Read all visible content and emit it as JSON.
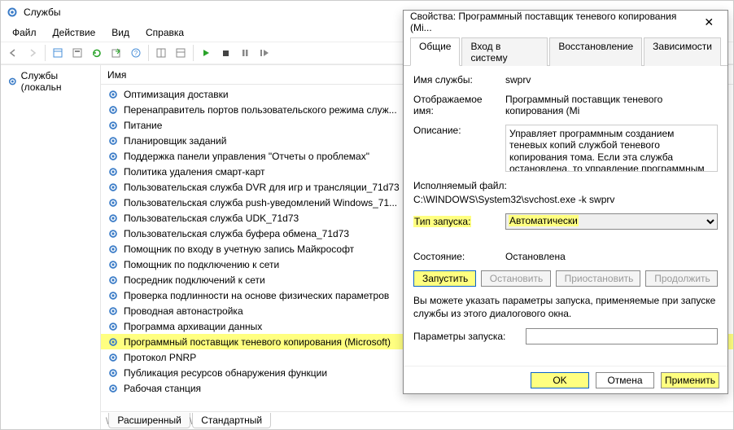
{
  "window": {
    "title": "Службы"
  },
  "menubar": [
    "Файл",
    "Действие",
    "Вид",
    "Справка"
  ],
  "leftPane": {
    "node": "Службы (локальн"
  },
  "list": {
    "header": "Имя",
    "items": [
      "Оптимизация доставки",
      "Перенаправитель портов пользовательского режима служ...",
      "Питание",
      "Планировщик заданий",
      "Поддержка панели управления \"Отчеты о проблемах\"",
      "Политика удаления смарт-карт",
      "Пользовательская служба DVR для игр и трансляции_71d73",
      "Пользовательская служба push-уведомлений Windows_71...",
      "Пользовательская служба UDK_71d73",
      "Пользовательская служба буфера обмена_71d73",
      "Помощник по входу в учетную запись Майкрософт",
      "Помощник по подключению к сети",
      "Посредник подключений к сети",
      "Проверка подлинности на основе физических параметров",
      "Проводная автонастройка",
      "Программа архивации данных",
      "Программный поставщик теневого копирования (Microsoft)",
      "Протокол PNRP",
      "Публикация ресурсов обнаружения функции",
      "Рабочая станция"
    ],
    "selectedIndex": 16
  },
  "bottomTabs": {
    "ext": "Расширенный",
    "std": "Стандартный"
  },
  "dialog": {
    "title": "Свойства: Программный поставщик теневого копирования (Mi...",
    "tabs": [
      "Общие",
      "Вход в систему",
      "Восстановление",
      "Зависимости"
    ],
    "labels": {
      "serviceNameLabel": "Имя службы:",
      "displayNameLabel": "Отображаемое имя:",
      "descLabel": "Описание:",
      "exeLabel": "Исполняемый файл:",
      "startupLabel": "Тип запуска:",
      "stateLabel": "Состояние:",
      "startParamsLabel": "Параметры запуска:",
      "note": "Вы можете указать параметры запуска, применяемые при запуске службы из этого диалогового окна."
    },
    "serviceName": "swprv",
    "displayName": "Программный поставщик теневого копирования (Mi",
    "description": "Управляет программным созданием теневых копий службой теневого копирования тома. Если эта служба остановлена, то управление программным созданием теневых копий",
    "exePath": "C:\\WINDOWS\\System32\\svchost.exe -k swprv",
    "startupValue": "Автоматически",
    "state": "Остановлена",
    "buttons": {
      "start": "Запустить",
      "stop": "Остановить",
      "pause": "Приостановить",
      "resume": "Продолжить"
    },
    "footer": {
      "ok": "OK",
      "cancel": "Отмена",
      "apply": "Применить"
    }
  }
}
